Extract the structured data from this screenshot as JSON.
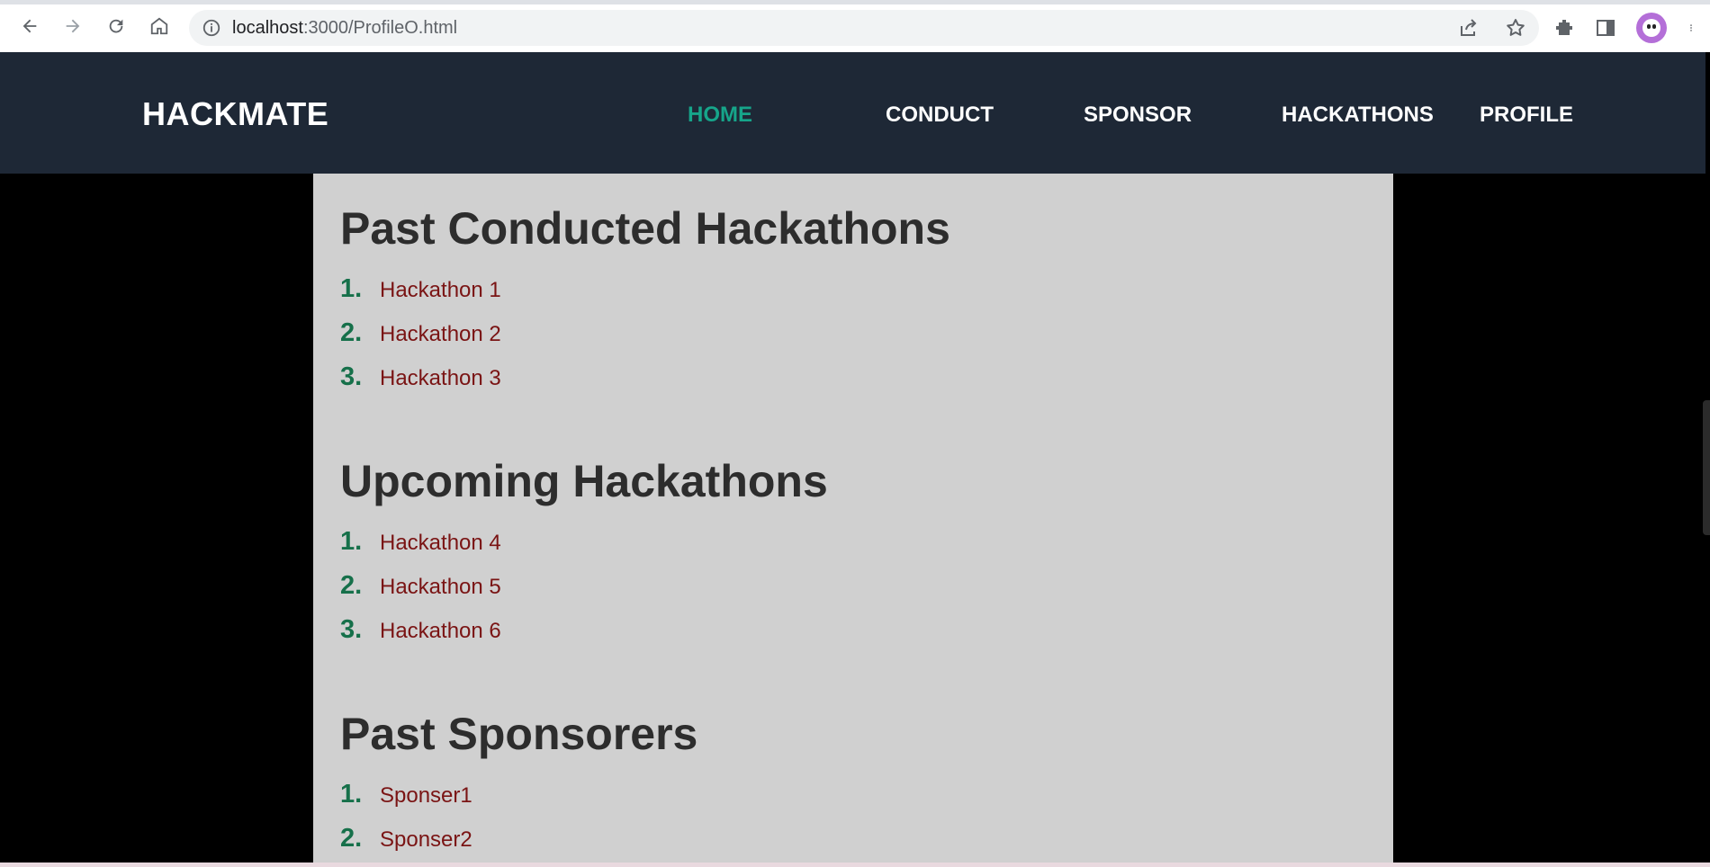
{
  "browser": {
    "url_host": "localhost",
    "url_path": ":3000/ProfileO.html"
  },
  "navbar": {
    "brand": "HACKMATE",
    "links": [
      "HOME",
      "CONDUCT",
      "SPONSOR",
      "HACKATHONS",
      "PROFILE"
    ],
    "active": "HOME",
    "active_color": "#16a58a",
    "background": "#1e2836"
  },
  "sections": [
    {
      "title": "Past Conducted Hackathons",
      "items": [
        {
          "num": "1.",
          "label": "Hackathon 1"
        },
        {
          "num": "2.",
          "label": "Hackathon 2"
        },
        {
          "num": "3.",
          "label": "Hackathon 3"
        }
      ]
    },
    {
      "title": "Upcoming Hackathons",
      "items": [
        {
          "num": "1.",
          "label": "Hackathon 4"
        },
        {
          "num": "2.",
          "label": "Hackathon 5"
        },
        {
          "num": "3.",
          "label": "Hackathon 6"
        }
      ]
    },
    {
      "title": "Past Sponsorers",
      "items": [
        {
          "num": "1.",
          "label": "Sponser1"
        },
        {
          "num": "2.",
          "label": "Sponser2"
        }
      ]
    }
  ],
  "colors": {
    "list_number": "#16704a",
    "list_link": "#7a1414",
    "panel": "#d0d0d0",
    "heading": "#2d2d2d"
  }
}
